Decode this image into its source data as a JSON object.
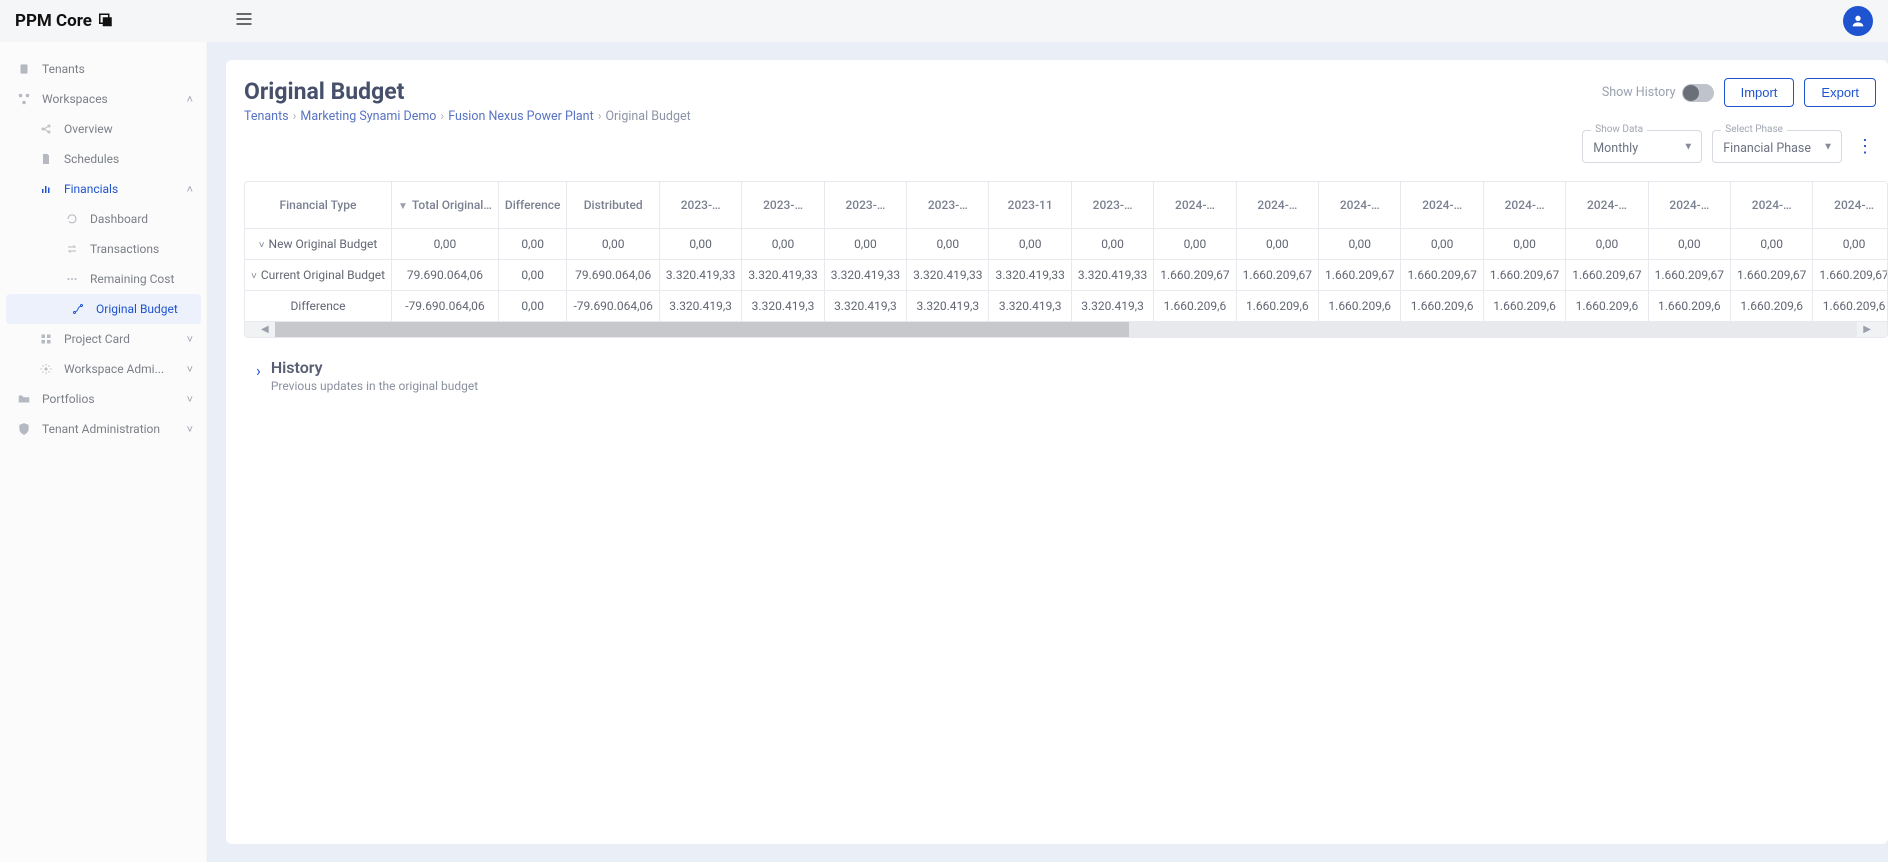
{
  "app": {
    "name": "PPM Core"
  },
  "header": {
    "show_history_label": "Show History",
    "import_label": "Import",
    "export_label": "Export"
  },
  "page": {
    "title": "Original Budget",
    "breadcrumb": {
      "b0": "Tenants",
      "b1": "Marketing Synami Demo",
      "b2": "Fusion Nexus Power Plant",
      "b3": "Original Budget"
    }
  },
  "controls": {
    "show_data_label": "Show Data",
    "show_data_value": "Monthly",
    "select_phase_label": "Select Phase",
    "select_phase_value": "Financial Phase"
  },
  "sidebar": {
    "tenants": "Tenants",
    "workspaces": "Workspaces",
    "overview": "Overview",
    "schedules": "Schedules",
    "financials": "Financials",
    "dashboard": "Dashboard",
    "transactions": "Transactions",
    "remaining_cost": "Remaining Cost",
    "original_budget": "Original Budget",
    "project_card": "Project Card",
    "workspace_admin": "Workspace Admi...",
    "portfolios": "Portfolios",
    "tenant_admin": "Tenant Administration"
  },
  "grid": {
    "headers": {
      "type": "Financial Type",
      "total": "Total Original…",
      "diff": "Difference",
      "dist": "Distributed",
      "months": [
        "2023-…",
        "2023-…",
        "2023-…",
        "2023-…",
        "2023-11",
        "2023-…",
        "2024-…",
        "2024-…",
        "2024-…",
        "2024-…",
        "2024-…",
        "2024-…",
        "2024-…",
        "2024-…",
        "2024-…"
      ]
    },
    "rows": [
      {
        "label": "New Original Budget",
        "expand": true,
        "total": "0,00",
        "diff": "0,00",
        "dist": "0,00",
        "cells": [
          "0,00",
          "0,00",
          "0,00",
          "0,00",
          "0,00",
          "0,00",
          "0,00",
          "0,00",
          "0,00",
          "0,00",
          "0,00",
          "0,00",
          "0,00",
          "0,00",
          "0,00"
        ]
      },
      {
        "label": "Current Original Budget",
        "expand": true,
        "total": "79.690.064,06",
        "diff": "0,00",
        "dist": "79.690.064,06",
        "cells": [
          "3.320.419,33",
          "3.320.419,33",
          "3.320.419,33",
          "3.320.419,33",
          "3.320.419,33",
          "3.320.419,33",
          "1.660.209,67",
          "1.660.209,67",
          "1.660.209,67",
          "1.660.209,67",
          "1.660.209,67",
          "1.660.209,67",
          "1.660.209,67",
          "1.660.209,67",
          "1.660.209,67"
        ]
      },
      {
        "label": "Difference",
        "expand": false,
        "neg": true,
        "total": "-79.690.064,06",
        "diff": "0,00",
        "dist": "-79.690.064,06",
        "cells": [
          "3.320.419,3",
          "3.320.419,3",
          "3.320.419,3",
          "3.320.419,3",
          "3.320.419,3",
          "3.320.419,3",
          "1.660.209,6",
          "1.660.209,6",
          "1.660.209,6",
          "1.660.209,6",
          "1.660.209,6",
          "1.660.209,6",
          "1.660.209,6",
          "1.660.209,6",
          "1.660.209,6"
        ]
      }
    ]
  },
  "history": {
    "title": "History",
    "subtitle": "Previous updates in the original budget"
  }
}
